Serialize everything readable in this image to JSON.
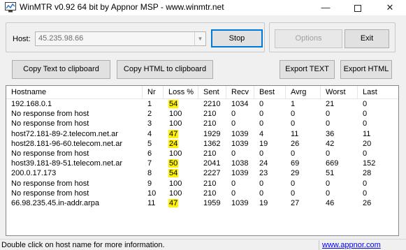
{
  "window": {
    "title": "WinMTR v0.92 64 bit by Appnor MSP - www.winmtr.net",
    "minimize": "—",
    "close": "✕"
  },
  "host_group": {
    "label": "Host:",
    "value": "45.235.98.66",
    "stop_button": "Stop"
  },
  "options_group": {
    "options_button": "Options",
    "exit_button": "Exit"
  },
  "actions": {
    "copy_text": "Copy Text to clipboard",
    "copy_html": "Copy HTML to clipboard",
    "export_text": "Export TEXT",
    "export_html": "Export HTML"
  },
  "table": {
    "columns": [
      "Hostname",
      "Nr",
      "Loss %",
      "Sent",
      "Recv",
      "Best",
      "Avrg",
      "Worst",
      "Last"
    ],
    "rows": [
      {
        "host": "192.168.0.1",
        "nr": "1",
        "loss": "54",
        "hl": true,
        "sent": "2210",
        "recv": "1034",
        "best": "0",
        "avrg": "1",
        "worst": "21",
        "last": "0"
      },
      {
        "host": "No response from host",
        "nr": "2",
        "loss": "100",
        "hl": false,
        "sent": "210",
        "recv": "0",
        "best": "0",
        "avrg": "0",
        "worst": "0",
        "last": "0"
      },
      {
        "host": "No response from host",
        "nr": "3",
        "loss": "100",
        "hl": false,
        "sent": "210",
        "recv": "0",
        "best": "0",
        "avrg": "0",
        "worst": "0",
        "last": "0"
      },
      {
        "host": "host72.181-89-2.telecom.net.ar",
        "nr": "4",
        "loss": "47",
        "hl": true,
        "sent": "1929",
        "recv": "1039",
        "best": "4",
        "avrg": "11",
        "worst": "36",
        "last": "11"
      },
      {
        "host": "host28.181-96-60.telecom.net.ar",
        "nr": "5",
        "loss": "24",
        "hl": true,
        "sent": "1362",
        "recv": "1039",
        "best": "19",
        "avrg": "26",
        "worst": "42",
        "last": "20"
      },
      {
        "host": "No response from host",
        "nr": "6",
        "loss": "100",
        "hl": false,
        "sent": "210",
        "recv": "0",
        "best": "0",
        "avrg": "0",
        "worst": "0",
        "last": "0"
      },
      {
        "host": "host39.181-89-51.telecom.net.ar",
        "nr": "7",
        "loss": "50",
        "hl": true,
        "sent": "2041",
        "recv": "1038",
        "best": "24",
        "avrg": "69",
        "worst": "669",
        "last": "152"
      },
      {
        "host": "200.0.17.173",
        "nr": "8",
        "loss": "54",
        "hl": true,
        "sent": "2227",
        "recv": "1039",
        "best": "23",
        "avrg": "29",
        "worst": "51",
        "last": "28"
      },
      {
        "host": "No response from host",
        "nr": "9",
        "loss": "100",
        "hl": false,
        "sent": "210",
        "recv": "0",
        "best": "0",
        "avrg": "0",
        "worst": "0",
        "last": "0"
      },
      {
        "host": "No response from host",
        "nr": "10",
        "loss": "100",
        "hl": false,
        "sent": "210",
        "recv": "0",
        "best": "0",
        "avrg": "0",
        "worst": "0",
        "last": "0"
      },
      {
        "host": "66.98.235.45.in-addr.arpa",
        "nr": "11",
        "loss": "47",
        "hl": true,
        "sent": "1959",
        "recv": "1039",
        "best": "19",
        "avrg": "27",
        "worst": "46",
        "last": "26"
      }
    ]
  },
  "status": {
    "text": "Double click on host name for more information.",
    "link": "www.appnor.com"
  },
  "colors": {
    "highlight": "#fff200",
    "link": "#0000ee",
    "default_button_border": "#0078d7"
  }
}
